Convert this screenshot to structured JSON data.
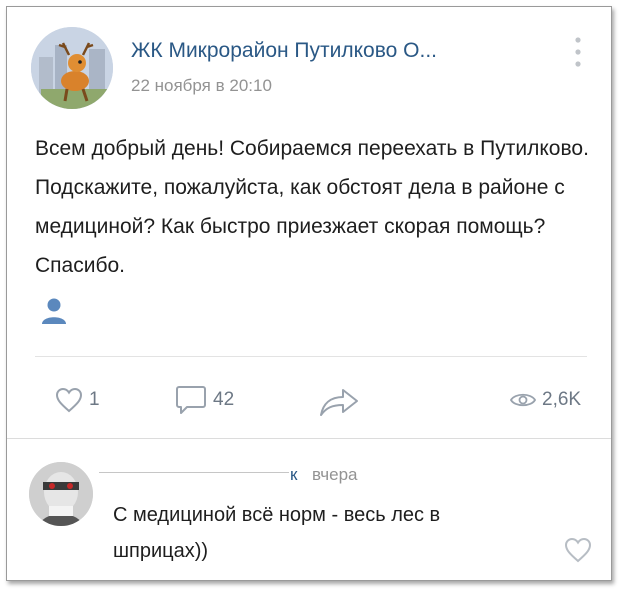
{
  "post": {
    "author": "ЖК Микрорайон Путилково О...",
    "date": "22 ноября в 20:10",
    "text": "Всем добрый день! Собираемся переехать в Путилково. Подскажите, пожалуйста, как обстоят дела в районе с медициной? Как быстро приезжает скорая помощь? Спасибо."
  },
  "actions": {
    "likes": "1",
    "comments": "42",
    "views": "2,6K"
  },
  "comment": {
    "author_suffix": "к",
    "date": "вчера",
    "text": "С медициной всё норм - весь лес в шприцах))"
  },
  "icons": {
    "more": "more-vertical-icon",
    "user": "user-icon",
    "like": "heart-icon",
    "comment": "comment-icon",
    "share": "share-icon",
    "views": "eye-icon"
  },
  "colors": {
    "link": "#2a5885",
    "muted": "#939393",
    "icon": "#99a2ad",
    "user_icon": "#5b88bd"
  }
}
